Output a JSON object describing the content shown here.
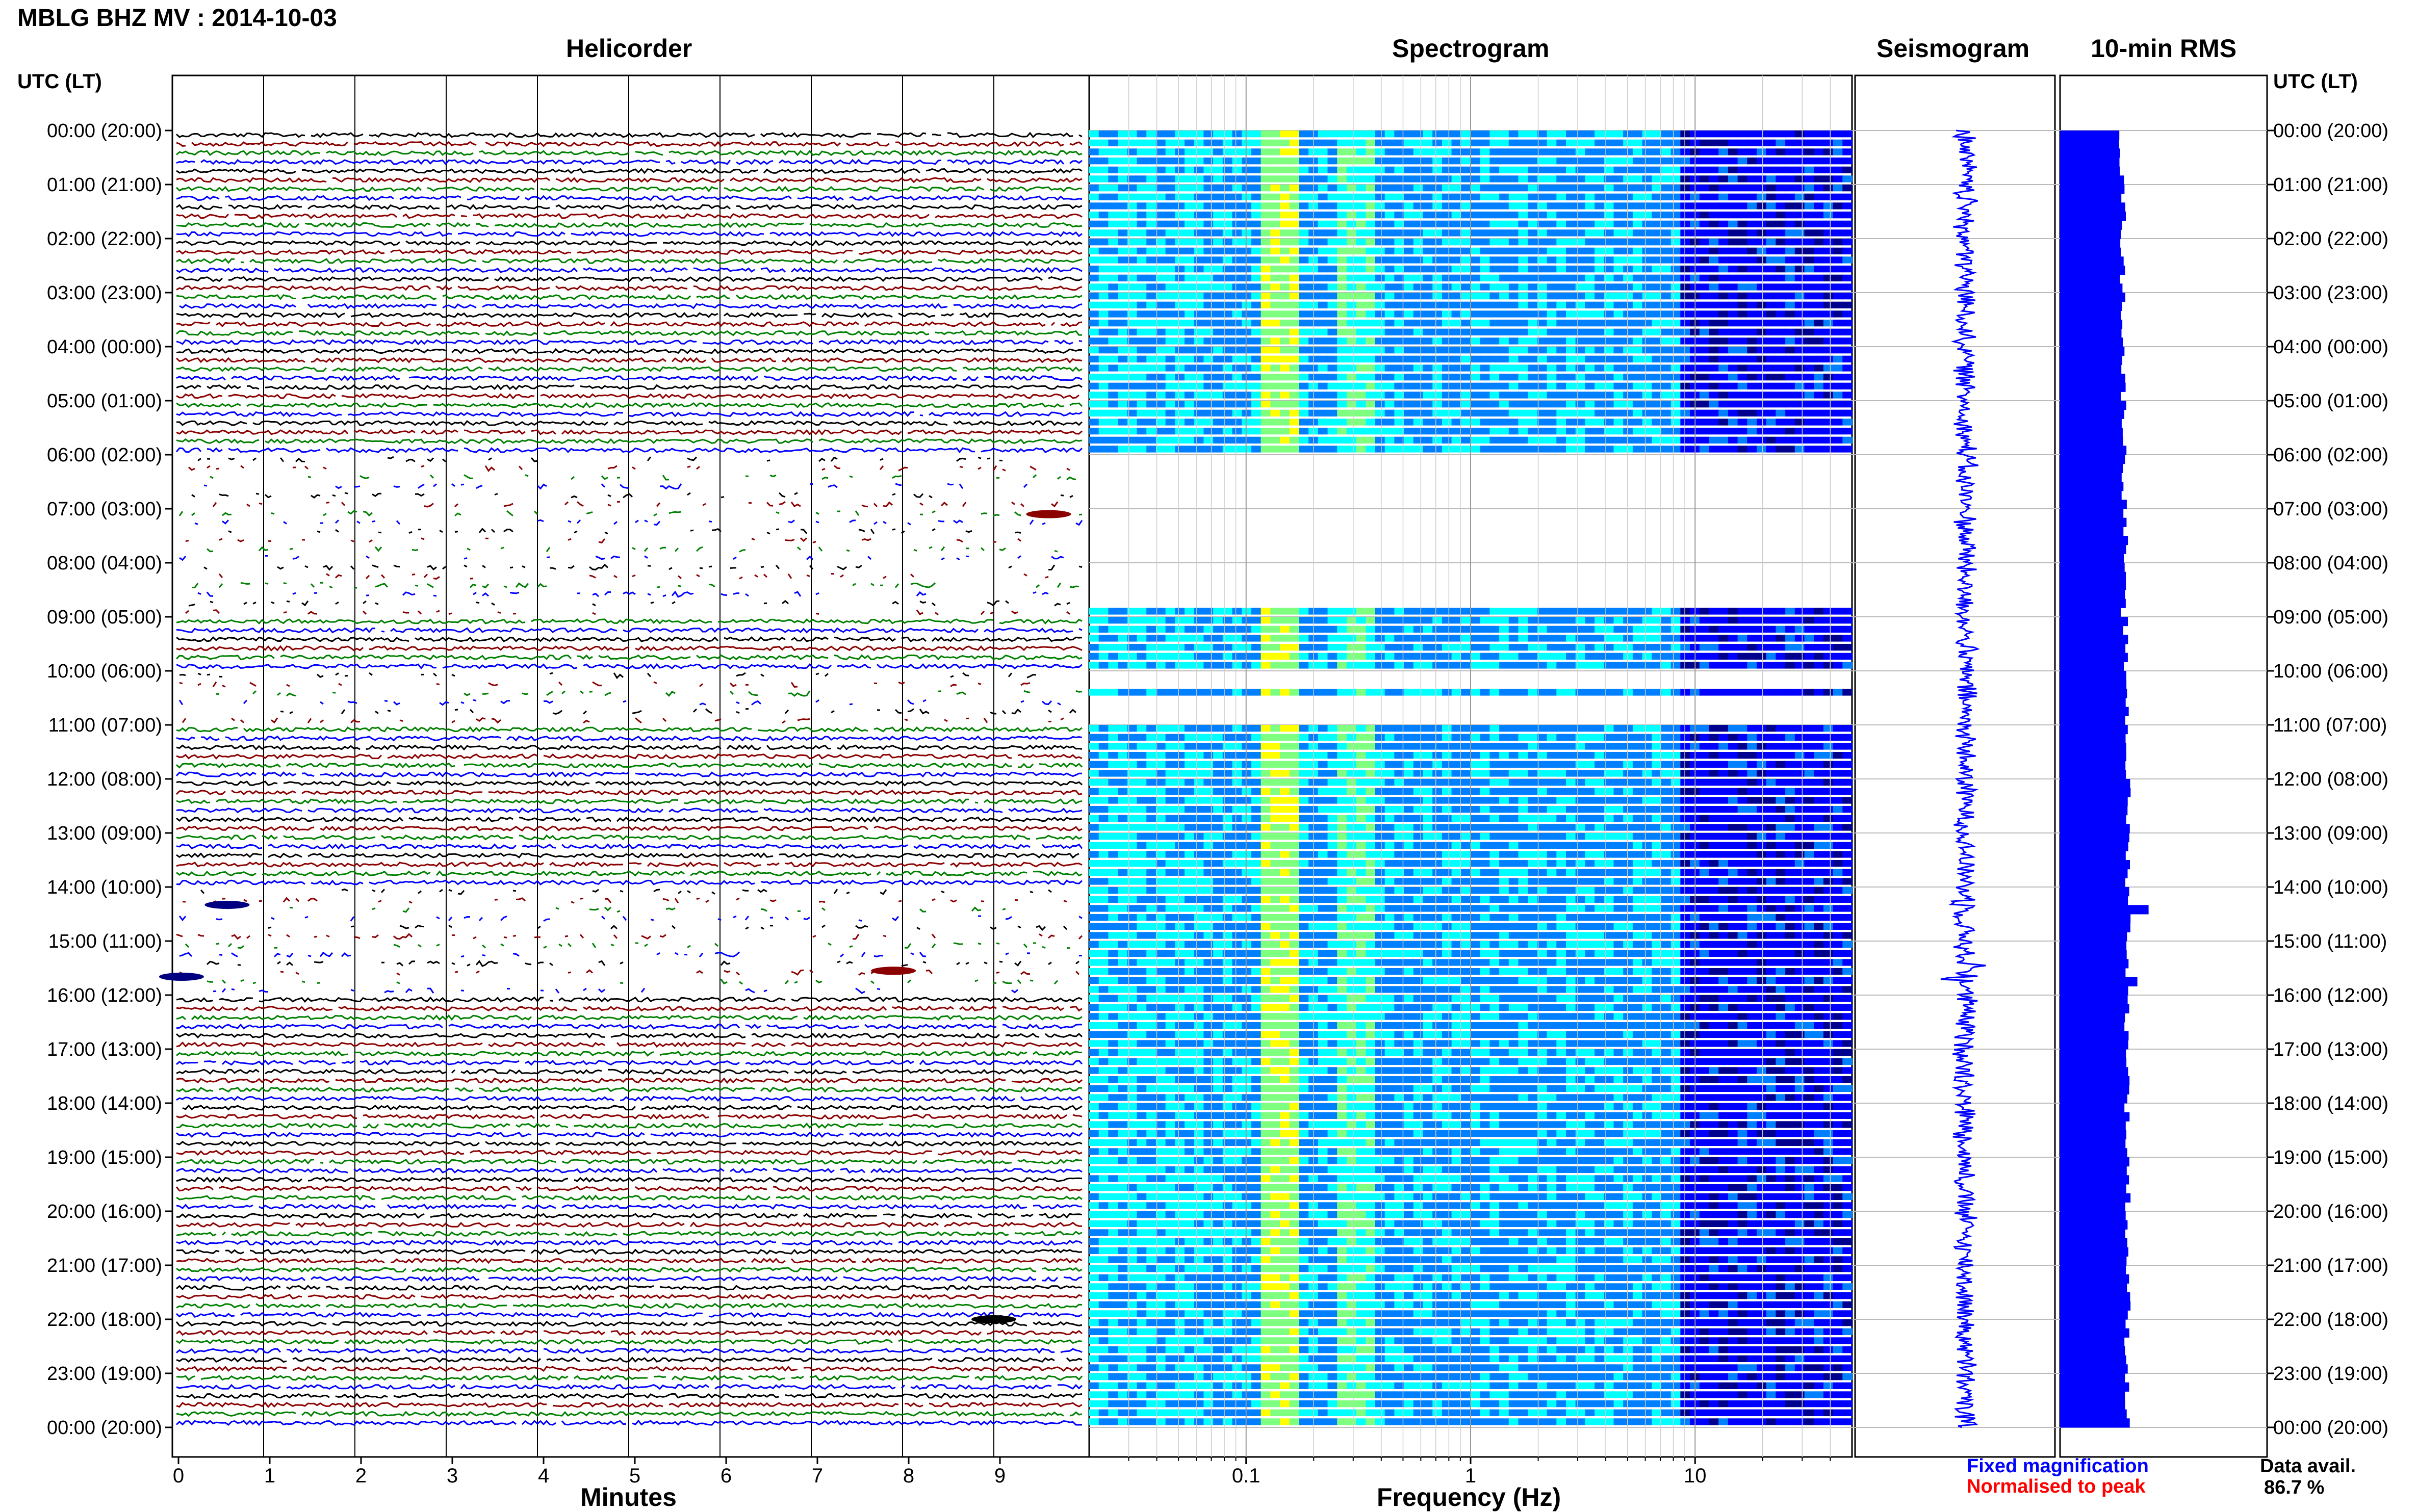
{
  "title": "MBLG BHZ MV : 2014-10-03",
  "panels": {
    "helicorder": "Helicorder",
    "spectrogram": "Spectrogram",
    "seismogram": "Seismogram",
    "rms": "10-min RMS"
  },
  "utc_header": "UTC (LT)",
  "hour_labels": [
    "00:00 (20:00)",
    "01:00 (21:00)",
    "02:00 (22:00)",
    "03:00 (23:00)",
    "04:00 (00:00)",
    "05:00 (01:00)",
    "06:00 (02:00)",
    "07:00 (03:00)",
    "08:00 (04:00)",
    "09:00 (05:00)",
    "10:00 (06:00)",
    "11:00 (07:00)",
    "12:00 (08:00)",
    "13:00 (09:00)",
    "14:00 (10:00)",
    "15:00 (11:00)",
    "16:00 (12:00)",
    "17:00 (13:00)",
    "18:00 (14:00)",
    "19:00 (15:00)",
    "20:00 (16:00)",
    "21:00 (17:00)",
    "22:00 (18:00)",
    "23:00 (19:00)",
    "00:00 (20:00)"
  ],
  "x_axis_minutes": {
    "label": "Minutes",
    "ticks": [
      "0",
      "1",
      "2",
      "3",
      "4",
      "5",
      "6",
      "7",
      "8",
      "9"
    ]
  },
  "x_axis_frequency": {
    "label": "Frequency (Hz)",
    "ticks": [
      "0.1",
      "1",
      "10"
    ],
    "scale": "log",
    "range_hz": [
      0.02,
      50
    ]
  },
  "legend": {
    "fixed": "Fixed magnification",
    "normalised": "Normalised to peak"
  },
  "data_availability": {
    "label": "Data avail.",
    "value": "86.7 %"
  },
  "colors": {
    "trace_cycle": [
      "#000000",
      "#8b0000",
      "#008000",
      "#0000ff"
    ],
    "seismogram": "#0000ff",
    "rms_bar": "#0000ff",
    "fixed_legend": "#0000ff",
    "normalised_legend": "#ff0000",
    "spectrogram_colormap": [
      "#00008f",
      "#0000ff",
      "#007fff",
      "#00ffff",
      "#7fff7f",
      "#ffff00"
    ]
  },
  "chart_data": [
    {
      "type": "line",
      "panel": "helicorder",
      "description_rows": "one trace per 10 minutes, 6 traces per hour, 24 hours",
      "xlabel": "Minutes",
      "xlim": [
        0,
        10
      ],
      "gaps_hours": [
        6,
        7,
        8,
        10,
        14,
        15
      ]
    },
    {
      "type": "heatmap",
      "panel": "spectrogram",
      "xlabel": "Frequency (Hz)",
      "xscale": "log",
      "xlim": [
        0.02,
        50
      ],
      "strong_band_hz": [
        0.12,
        0.16
      ],
      "secondary_band_hz": [
        0.25,
        0.35
      ]
    },
    {
      "type": "line",
      "panel": "seismogram",
      "ylim_hours": [
        0,
        24
      ]
    },
    {
      "type": "bar",
      "panel": "10-min RMS",
      "orientation": "horizontal",
      "categories_hours": [
        0,
        1,
        2,
        3,
        4,
        5,
        6,
        7,
        8,
        9,
        10,
        11,
        12,
        13,
        14,
        15,
        16,
        17,
        18,
        19,
        20,
        21,
        22,
        23
      ],
      "values_relative": [
        0.66,
        0.68,
        0.67,
        0.68,
        0.68,
        0.69,
        0.69,
        0.7,
        0.68,
        0.7,
        0.72,
        0.72,
        0.73,
        0.73,
        0.74,
        0.73,
        0.72,
        0.73,
        0.72,
        0.73,
        0.72,
        0.73,
        0.72,
        0.72
      ],
      "peaks": [
        {
          "hour": 7.0,
          "value": 0.68
        },
        {
          "hour": 14.3,
          "value": 0.95
        },
        {
          "hour": 15.6,
          "value": 0.83
        }
      ]
    }
  ]
}
